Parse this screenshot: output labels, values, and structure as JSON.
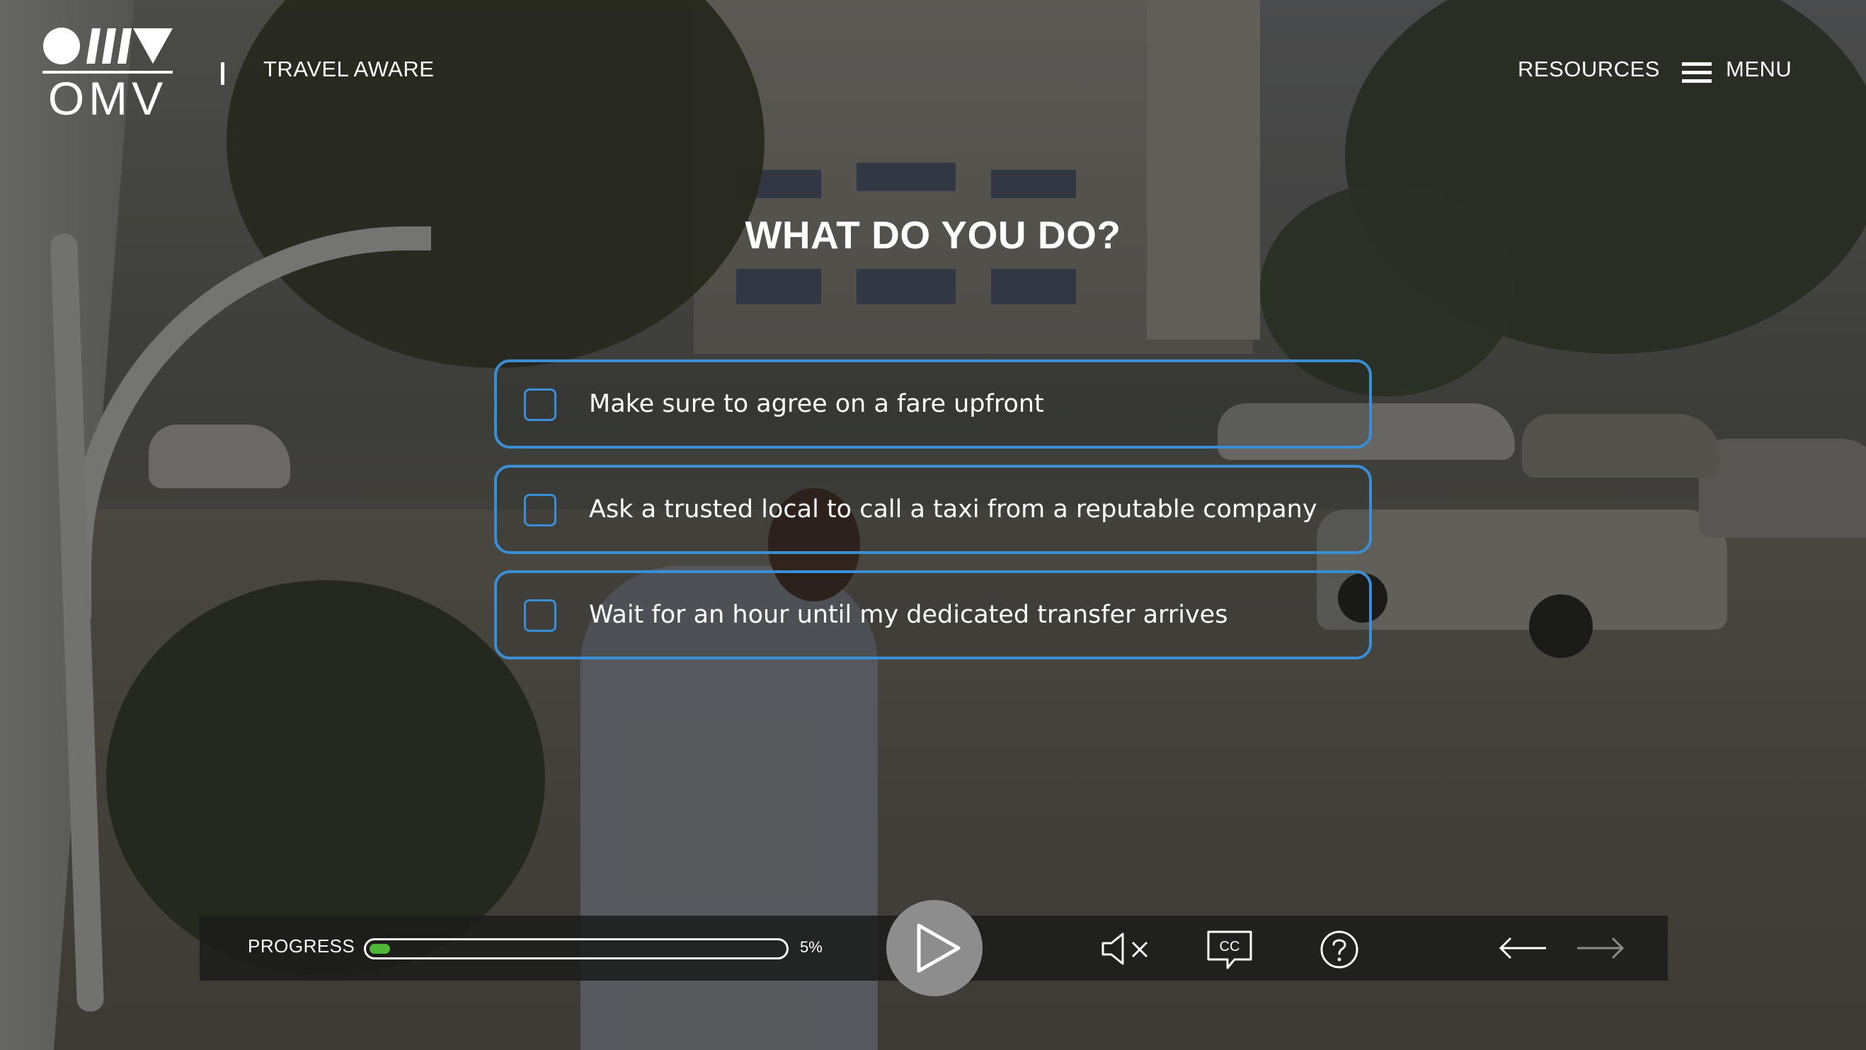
{
  "brand": {
    "logo_text": "OMV",
    "course_title": "TRAVEL AWARE"
  },
  "header": {
    "resources_label": "RESOURCES",
    "menu_label": "MENU"
  },
  "question": {
    "title": "WHAT DO YOU DO?",
    "options": [
      {
        "label": "Make sure to agree on a fare upfront",
        "checked": false
      },
      {
        "label": "Ask a trusted local to call a taxi from a reputable company",
        "checked": false
      },
      {
        "label": "Wait for an hour until my dedicated transfer arrives",
        "checked": false
      }
    ]
  },
  "controls": {
    "progress_label": "PROGRESS",
    "progress_percent": 5,
    "progress_text": "5%",
    "icons": [
      "play-icon",
      "mute-icon",
      "closed-captions-icon",
      "help-icon",
      "back-arrow-icon",
      "next-arrow-icon"
    ]
  },
  "colors": {
    "accent": "#3a8ed6",
    "progress": "#4fb83a",
    "bar": "#1c1c1c",
    "play_button": "#8d8d8d"
  }
}
